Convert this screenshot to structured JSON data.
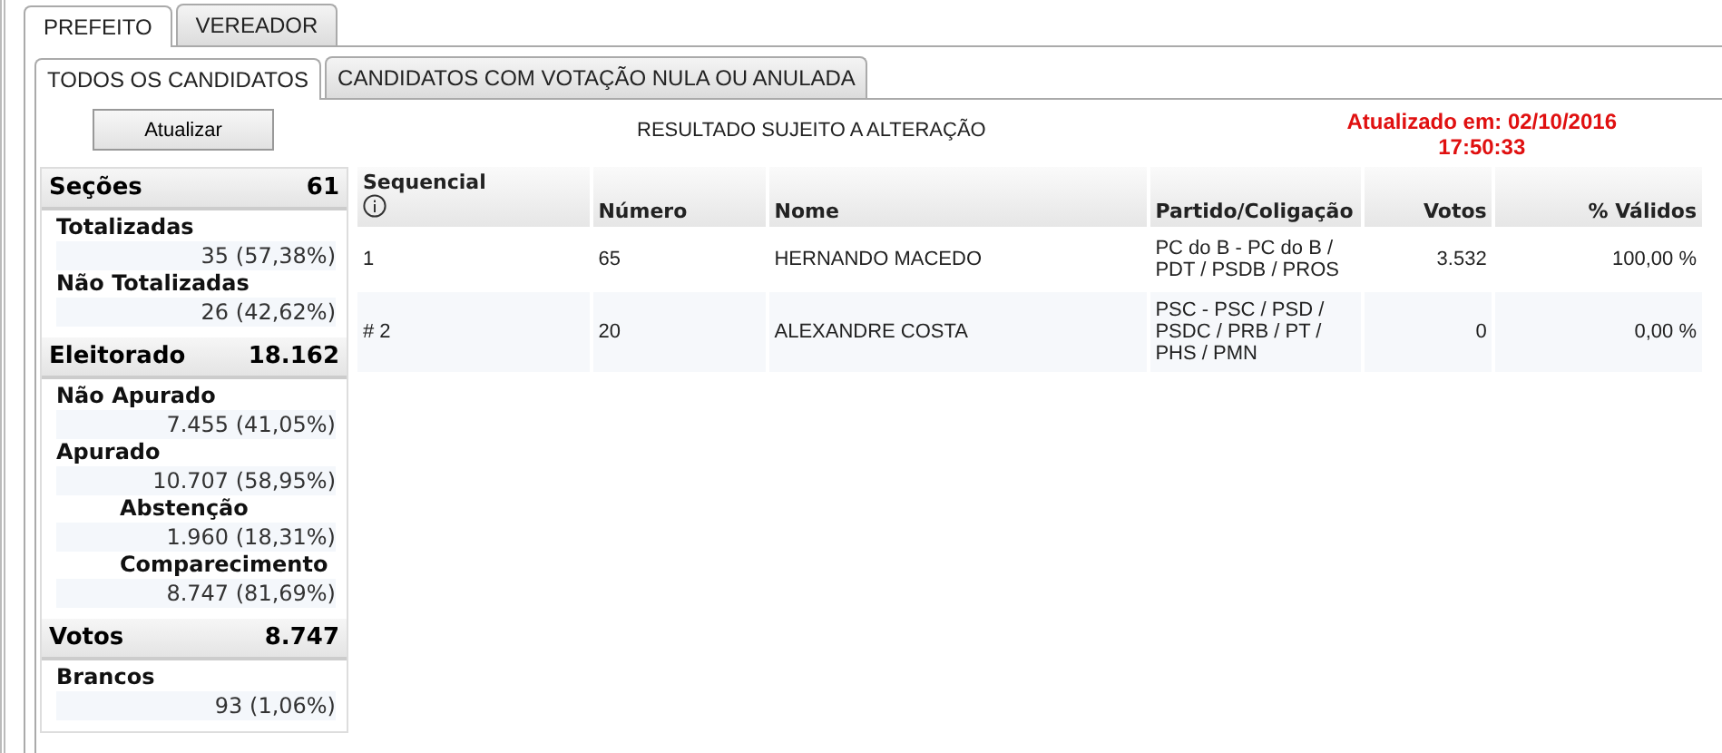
{
  "tabs": [
    {
      "label": "PREFEITO",
      "selected": true
    },
    {
      "label": "VEREADOR",
      "selected": false
    }
  ],
  "subtabs": [
    {
      "label": "TODOS OS CANDIDATOS",
      "selected": true
    },
    {
      "label": "CANDIDATOS COM VOTAÇÃO NULA OU ANULADA",
      "selected": false
    }
  ],
  "refresh_button": "Atualizar",
  "notice": "RESULTADO SUJEITO A ALTERAÇÃO",
  "updated": [
    "Atualizado em: 02/10/2016",
    "17:50:33"
  ],
  "summary": [
    {
      "label": "Seções",
      "value": "61",
      "items": [
        {
          "label": "Totalizadas",
          "value": "35 (57,38%)"
        },
        {
          "label": "Não Totalizadas",
          "value": "26 (42,62%)"
        }
      ]
    },
    {
      "label": "Eleitorado",
      "value": "18.162",
      "items": [
        {
          "label": "Não Apurado",
          "value": "7.455 (41,05%)"
        },
        {
          "label": "Apurado",
          "value": "10.707 (58,95%)",
          "children": [
            {
              "label": "Abstenção",
              "value": "1.960 (18,31%)"
            },
            {
              "label": "Comparecimento",
              "value": "8.747 (81,69%)"
            }
          ]
        }
      ]
    },
    {
      "label": "Votos",
      "value": "8.747",
      "items": [
        {
          "label": "Brancos",
          "value": "93 (1,06%)"
        }
      ]
    }
  ],
  "table": {
    "columns": [
      "Sequencial",
      "Número",
      "Nome",
      "Partido/Coligação",
      "Votos",
      "% Válidos"
    ],
    "rows": [
      [
        "1",
        "65",
        "HERNANDO MACEDO",
        "PC do B - PC do B / PDT / PSDB / PROS",
        "3.532",
        "100,00 %"
      ],
      [
        "# 2",
        "20",
        "ALEXANDRE COSTA",
        "PSC - PSC / PSD / PSDC / PRB / PT / PHS / PMN",
        "0",
        "0,00 %"
      ]
    ]
  }
}
